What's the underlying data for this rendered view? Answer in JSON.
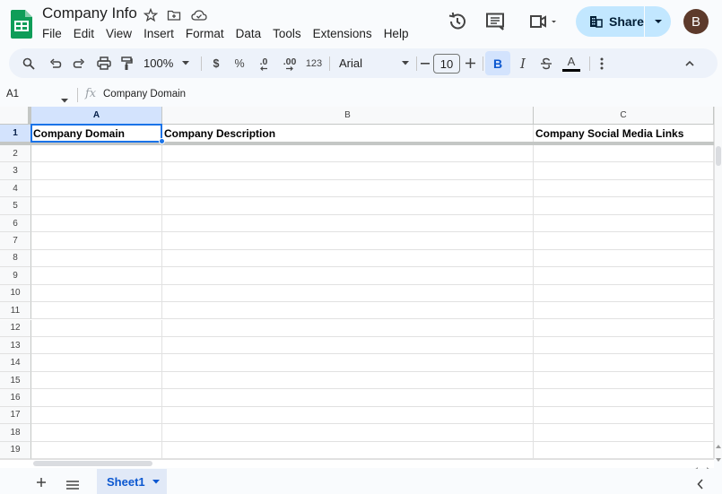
{
  "app": {
    "title": "Company Info",
    "menu": [
      "File",
      "Edit",
      "View",
      "Insert",
      "Format",
      "Data",
      "Tools",
      "Extensions",
      "Help"
    ],
    "share_label": "Share",
    "avatar_initial": "B"
  },
  "toolbar": {
    "zoom": "100%",
    "currency": "$",
    "percent": "%",
    "decrease_decimal": ".0",
    "increase_decimal": ".00",
    "number_format": "123",
    "font": "Arial",
    "font_size": "10",
    "bold": "B",
    "italic": "I",
    "text_color": "A"
  },
  "formula_bar": {
    "name_box": "A1",
    "fx": "fx",
    "value": "Company Domain"
  },
  "grid": {
    "columns": [
      "A",
      "B",
      "C"
    ],
    "selected_column": "A",
    "selected_cell": "A1",
    "rows": [
      "1",
      "2",
      "3",
      "4",
      "5",
      "6",
      "7",
      "8",
      "9",
      "10",
      "11",
      "12",
      "13",
      "14",
      "15",
      "16",
      "17",
      "18",
      "19"
    ],
    "header_cells": [
      "Company Domain",
      "Company Description",
      "Company Social Media Links"
    ]
  },
  "sheets": {
    "tabs": [
      {
        "label": "Sheet1",
        "active": true
      }
    ]
  },
  "colors": {
    "accent": "#1a73e8",
    "share_bg": "#c2e7ff",
    "selected_header": "#d3e3fd",
    "logo_green": "#0f9d58"
  }
}
